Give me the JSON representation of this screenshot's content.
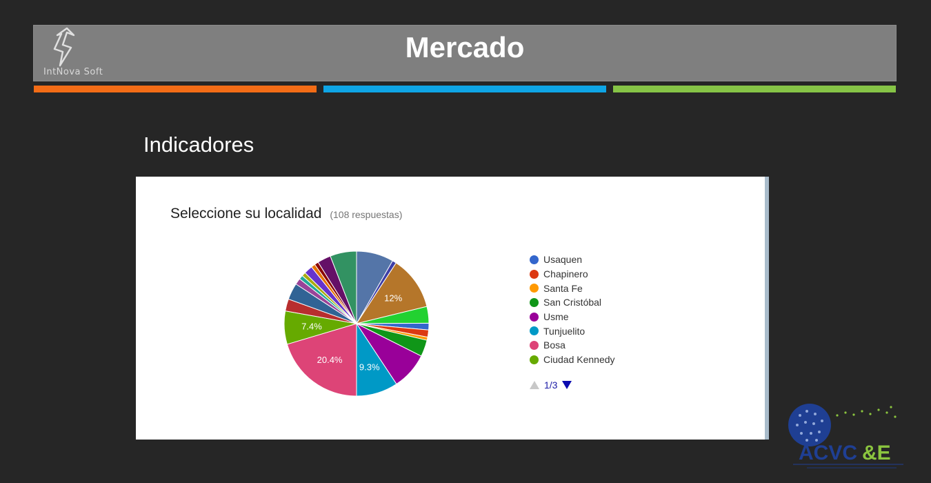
{
  "header": {
    "title": "Mercado",
    "logo_text": "IntNova Soft",
    "stripe_colors": [
      "#f36c16",
      "#0ea5e5",
      "#86c446"
    ]
  },
  "section": {
    "heading": "Indicadores"
  },
  "chart_card": {
    "title": "Seleccione su localidad",
    "response_count": "(108 respuestas)",
    "pager": {
      "label": "1/3",
      "up_icon": "triangle-up-icon",
      "down_icon": "triangle-down-icon"
    }
  },
  "chart_data": {
    "type": "pie",
    "title": "Seleccione su localidad",
    "start_angle_deg": 0,
    "legend_position": "right",
    "slices": [
      {
        "label": "",
        "value": 8.3,
        "color": "#5475a8",
        "data_label": ""
      },
      {
        "label": "",
        "value": 0.9,
        "color": "#3e3ea6",
        "data_label": ""
      },
      {
        "label": "",
        "value": 12.0,
        "color": "#b5762a",
        "data_label": "12%"
      },
      {
        "label": "",
        "value": 3.7,
        "color": "#22d131",
        "data_label": ""
      },
      {
        "label": "Usaquen",
        "value": 1.5,
        "color": "#3366cc",
        "data_label": ""
      },
      {
        "label": "Chapinero",
        "value": 1.6,
        "color": "#dc3912",
        "data_label": ""
      },
      {
        "label": "Santa Fe",
        "value": 0.7,
        "color": "#ff9900",
        "data_label": ""
      },
      {
        "label": "San Cristóbal",
        "value": 3.7,
        "color": "#109618",
        "data_label": ""
      },
      {
        "label": "Usme",
        "value": 8.3,
        "color": "#990099",
        "data_label": ""
      },
      {
        "label": "Tunjuelito",
        "value": 9.3,
        "color": "#0099c6",
        "data_label": "9.3%"
      },
      {
        "label": "Bosa",
        "value": 20.4,
        "color": "#dd4477",
        "data_label": "20.4%"
      },
      {
        "label": "Ciudad Kennedy",
        "value": 7.4,
        "color": "#66aa00",
        "data_label": "7.4%"
      },
      {
        "label": "",
        "value": 2.7,
        "color": "#b82e2e",
        "data_label": ""
      },
      {
        "label": "",
        "value": 3.7,
        "color": "#316395",
        "data_label": ""
      },
      {
        "label": "",
        "value": 1.4,
        "color": "#994499",
        "data_label": ""
      },
      {
        "label": "",
        "value": 0.9,
        "color": "#22aa99",
        "data_label": ""
      },
      {
        "label": "",
        "value": 0.9,
        "color": "#aaaa11",
        "data_label": ""
      },
      {
        "label": "",
        "value": 1.9,
        "color": "#6633cc",
        "data_label": ""
      },
      {
        "label": "",
        "value": 0.9,
        "color": "#e67300",
        "data_label": ""
      },
      {
        "label": "",
        "value": 0.9,
        "color": "#8b0707",
        "data_label": ""
      },
      {
        "label": "",
        "value": 3.0,
        "color": "#651067",
        "data_label": ""
      },
      {
        "label": "",
        "value": 5.9,
        "color": "#329262",
        "data_label": ""
      }
    ],
    "legend": [
      {
        "label": "Usaquen",
        "color": "#3366cc"
      },
      {
        "label": "Chapinero",
        "color": "#dc3912"
      },
      {
        "label": "Santa Fe",
        "color": "#ff9900"
      },
      {
        "label": "San Cristóbal",
        "color": "#109618"
      },
      {
        "label": "Usme",
        "color": "#990099"
      },
      {
        "label": "Tunjuelito",
        "color": "#0099c6"
      },
      {
        "label": "Bosa",
        "color": "#dd4477"
      },
      {
        "label": "Ciudad Kennedy",
        "color": "#66aa00"
      }
    ]
  },
  "footer_logo": {
    "name": "ACVC&E",
    "colors": [
      "#1f3f93",
      "#8bc53f"
    ]
  }
}
